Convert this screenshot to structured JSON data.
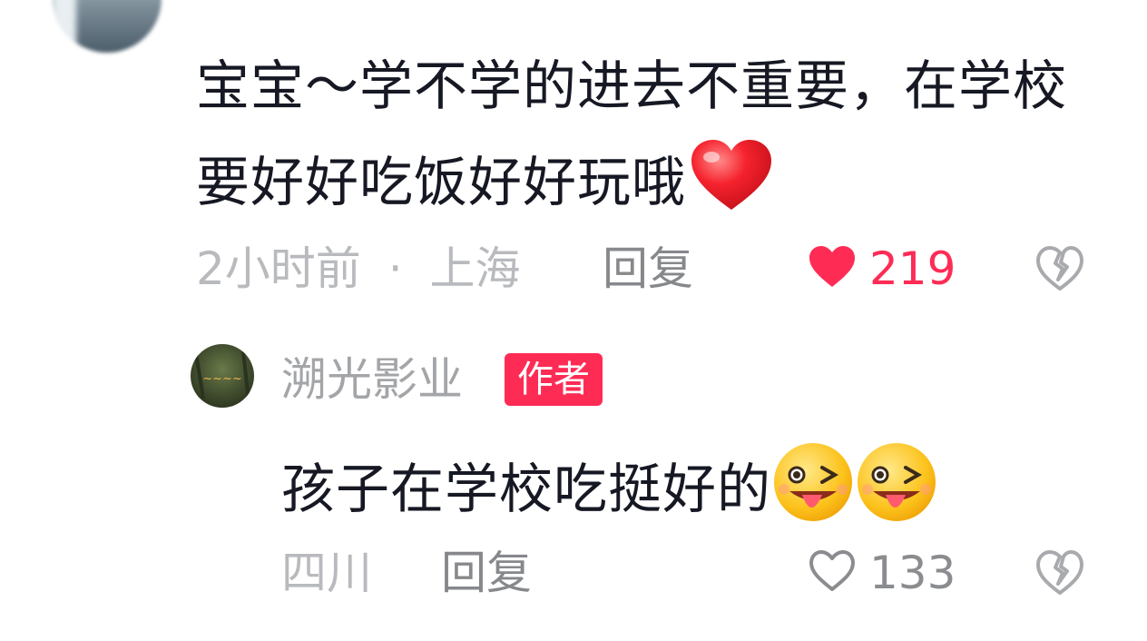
{
  "comment": {
    "text": "宝宝～学不学的进去不重要，在学校要好好吃饭好好玩哦",
    "emoji": "red-heart",
    "time": "2小时前",
    "separator": "·",
    "location": "上海",
    "reply_label": "回复",
    "likes": "219",
    "liked": true
  },
  "reply": {
    "author": "溯光影业",
    "badge": "作者",
    "text": "孩子在学校吃挺好的",
    "emojis": [
      "tongue-wink-face",
      "tongue-wink-face"
    ],
    "location": "四川",
    "reply_label": "回复",
    "likes": "133",
    "liked": false
  },
  "colors": {
    "accent": "#fe2c55",
    "text": "#161823",
    "meta": "#b8babd",
    "reply_btn": "#86888b"
  }
}
